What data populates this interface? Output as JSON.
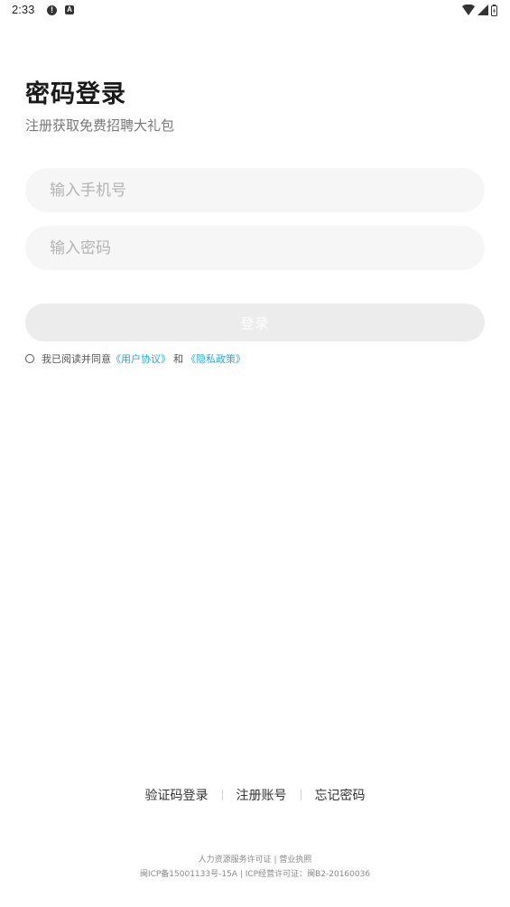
{
  "status_bar": {
    "time": "2:33",
    "alert_glyph": "!",
    "a_glyph": "A",
    "icons": [
      "alert-icon",
      "a-icon",
      "wifi-icon",
      "signal-icon",
      "battery-icon"
    ]
  },
  "header": {
    "title": "密码登录",
    "subtitle": "注册获取免费招聘大礼包"
  },
  "form": {
    "phone_placeholder": "输入手机号",
    "password_placeholder": "输入密码",
    "login_label": "登录"
  },
  "agreement": {
    "prefix": "我已阅读并同意",
    "user_agreement": "《用户协议》",
    "and": "和",
    "privacy_policy": "《隐私政策》"
  },
  "bottom_links": {
    "sms_login": "验证码登录",
    "register": "注册账号",
    "forgot_password": "忘记密码",
    "divider": "|"
  },
  "footer": {
    "line1": "人力资源服务许可证 | 营业执照",
    "line2": "闽ICP备15001133号-15A | ICP经营许可证：闽B2-20160036"
  },
  "colors": {
    "link": "#2aa7d8",
    "input_bg": "#f6f6f6",
    "button_bg": "#ececec"
  }
}
